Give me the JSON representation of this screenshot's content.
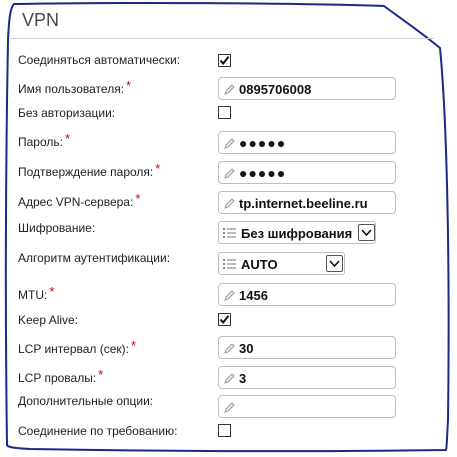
{
  "panel": {
    "title": "VPN"
  },
  "fields": {
    "auto_connect": {
      "label": "Соединяться автоматически:",
      "checked": true
    },
    "username": {
      "label": "Имя пользователя:",
      "required_mark": "*",
      "value": "0895706008"
    },
    "no_auth": {
      "label": "Без авторизации:",
      "checked": false
    },
    "password": {
      "label": "Пароль:",
      "required_mark": "*",
      "value": "●●●●●"
    },
    "password_confirm": {
      "label": "Подтверждение пароля:",
      "required_mark": "*",
      "value": "●●●●●"
    },
    "vpn_server": {
      "label": "Адрес VPN-сервера:",
      "required_mark": "*",
      "value": "tp.internet.beeline.ru"
    },
    "encryption": {
      "label": "Шифрование:",
      "value": "Без шифрования"
    },
    "auth_algorithm": {
      "label": "Алгоритм аутентификации:",
      "value": "AUTO"
    },
    "mtu": {
      "label": "MTU:",
      "required_mark": "*",
      "value": "1456"
    },
    "keep_alive": {
      "label": "Keep Alive:",
      "checked": true
    },
    "lcp_interval": {
      "label": "LCP интервал (сек):",
      "required_mark": "*",
      "value": "30"
    },
    "lcp_failures": {
      "label": "LCP провалы:",
      "required_mark": "*",
      "value": "3"
    },
    "extra_options": {
      "label": "Дополнительные опции:",
      "value": ""
    },
    "on_demand": {
      "label": "Соединение по требованию:",
      "checked": false
    }
  },
  "colors": {
    "frame_stroke": "#1a2a8a",
    "required": "#d40000",
    "panel_bg": "#ffffff"
  },
  "icons": {
    "pen": "pencil-icon",
    "list": "list-icon",
    "arrow": "chevron-down-icon",
    "check": "check-icon"
  }
}
